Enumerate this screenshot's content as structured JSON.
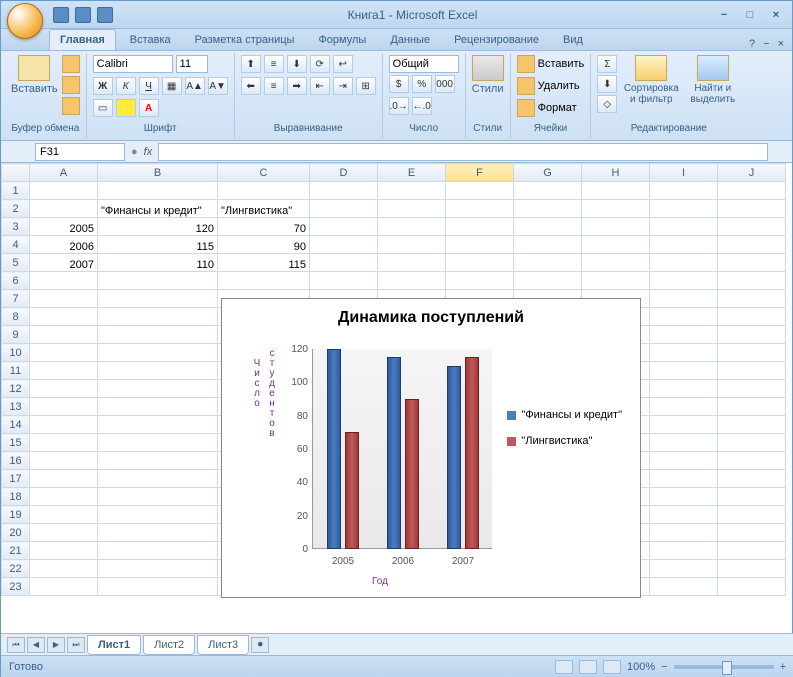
{
  "title": "Книга1 - Microsoft Excel",
  "tabs": [
    "Главная",
    "Вставка",
    "Разметка страницы",
    "Формулы",
    "Данные",
    "Рецензирование",
    "Вид"
  ],
  "ribbon": {
    "clipboard": {
      "title": "Буфер обмена",
      "paste": "Вставить"
    },
    "font": {
      "title": "Шрифт",
      "name": "Calibri",
      "size": "11",
      "bold": "Ж",
      "italic": "К",
      "underline": "Ч"
    },
    "align": {
      "title": "Выравнивание"
    },
    "number": {
      "title": "Число",
      "format": "Общий"
    },
    "styles": {
      "title": "Стили",
      "btn": "Стили"
    },
    "cells": {
      "title": "Ячейки",
      "insert": "Вставить",
      "delete": "Удалить",
      "format": "Формат"
    },
    "edit": {
      "title": "Редактирование",
      "sort": "Сортировка и фильтр",
      "find": "Найти и выделить"
    }
  },
  "namebox": "F31",
  "cols": [
    "A",
    "B",
    "C",
    "D",
    "E",
    "F",
    "G",
    "H",
    "I",
    "J"
  ],
  "rows": [
    "1",
    "2",
    "3",
    "4",
    "5",
    "6",
    "7",
    "8",
    "9",
    "10",
    "11",
    "12",
    "13",
    "14",
    "15",
    "16",
    "17",
    "18",
    "19",
    "20",
    "21",
    "22",
    "23"
  ],
  "cells": {
    "B2": "\"Финансы и кредит\"",
    "C2": "\"Лингвистика\"",
    "A3": "2005",
    "B3": "120",
    "C3": "70",
    "A4": "2006",
    "B4": "115",
    "C4": "90",
    "A5": "2007",
    "B5": "110",
    "C5": "115"
  },
  "chart_data": {
    "type": "bar",
    "title": "Динамика поступлений",
    "xlabel": "Год",
    "ylabel": "Число студентов",
    "ylim": [
      0,
      120
    ],
    "yticks": [
      0,
      20,
      40,
      60,
      80,
      100,
      120
    ],
    "categories": [
      "2005",
      "2006",
      "2007"
    ],
    "series": [
      {
        "name": "\"Финансы и кредит\"",
        "values": [
          120,
          115,
          110
        ],
        "color": "#4a7cc0"
      },
      {
        "name": "\"Лингвистика\"",
        "values": [
          70,
          90,
          115
        ],
        "color": "#c05a5a"
      }
    ]
  },
  "sheets": [
    "Лист1",
    "Лист2",
    "Лист3"
  ],
  "status": {
    "ready": "Готово",
    "zoom": "100%"
  }
}
